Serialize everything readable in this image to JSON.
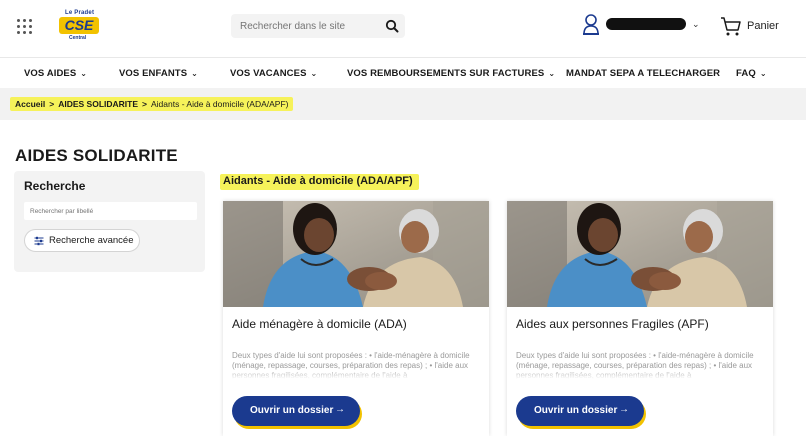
{
  "header": {
    "search_placeholder": "Rechercher dans le site",
    "logo": {
      "top": "Le Pradet",
      "main": "CSE",
      "bottom": "Central"
    },
    "user_name": "",
    "cart_label": "Panier"
  },
  "nav": {
    "items": [
      {
        "label": "VOS AIDES",
        "has_dropdown": true
      },
      {
        "label": "VOS ENFANTS",
        "has_dropdown": true
      },
      {
        "label": "VOS VACANCES",
        "has_dropdown": true
      },
      {
        "label": "VOS REMBOURSEMENTS SUR FACTURES",
        "has_dropdown": true
      },
      {
        "label": "MANDAT SEPA A TELECHARGER",
        "has_dropdown": false
      },
      {
        "label": "FAQ",
        "has_dropdown": true
      }
    ],
    "chevron": "⌄"
  },
  "breadcrumb": {
    "home": "Accueil",
    "separator": ">",
    "section": "AIDES SOLIDARITE",
    "current": "Aidants - Aide à domicile (ADA/APF)"
  },
  "page_title": "AIDES SOLIDARITE",
  "sidebar": {
    "title": "Recherche",
    "search_placeholder": "Rechercher par libellé",
    "advanced_label": "Recherche avancée"
  },
  "section_title": "Aidants - Aide à domicile (ADA/APF)",
  "cards": [
    {
      "title": "Aide ménagère à domicile (ADA)",
      "description": "Deux types d'aide lui sont proposées : • l'aide-ménagère à domicile (ménage, repassage, courses, préparation des repas) ; • l'aide aux personnes fragilisées, complémentaire de l'aide à",
      "button_label": "Ouvrir un dossier",
      "button_arrow": "→"
    },
    {
      "title": "Aides aux personnes Fragiles (APF)",
      "description": "Deux types d'aide lui sont proposées : • l'aide-ménagère à domicile (ménage, repassage, courses, préparation des repas) ; • l'aide aux personnes fragilisées, complémentaire de l'aide à",
      "button_label": "Ouvrir un dossier",
      "button_arrow": "→"
    }
  ],
  "colors": {
    "brand_blue": "#1b3a8f",
    "brand_yellow": "#f2c200",
    "highlight": "#f6f25a"
  }
}
